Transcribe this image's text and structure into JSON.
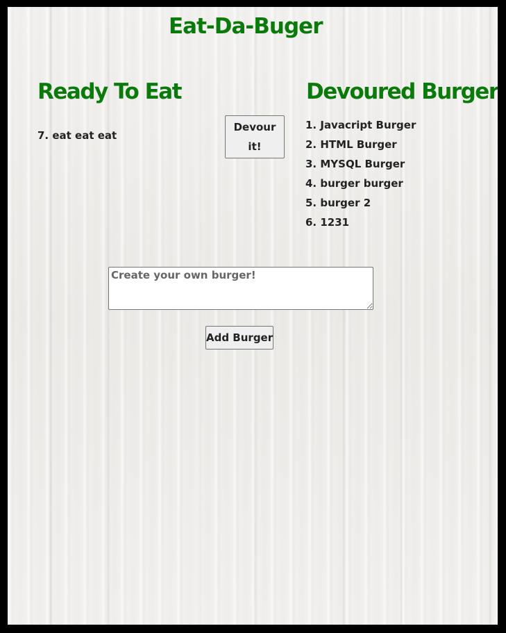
{
  "page": {
    "title": "Eat-Da-Buger"
  },
  "ready": {
    "heading": "Ready To Eat",
    "items": [
      {
        "label": "7. eat eat eat",
        "button_label": "Devour it!"
      }
    ]
  },
  "devoured": {
    "heading": "Devoured Burgers",
    "items": [
      "1. Javacript Burger",
      "2. HTML Burger",
      "3. MYSQL Burger",
      "4. burger burger",
      "5. burger 2",
      "6. 1231"
    ]
  },
  "form": {
    "textarea_placeholder": "Create your own burger!",
    "textarea_value": "",
    "submit_label": "Add Burger"
  },
  "colors": {
    "heading": "#0a7a0a",
    "text": "#222222",
    "frame_border": "#000000"
  }
}
